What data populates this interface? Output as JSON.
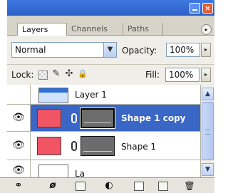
{
  "window": {
    "close_glyph": "×"
  },
  "tabs": [
    {
      "label": "Layers",
      "active": true
    },
    {
      "label": "Channels",
      "active": false
    },
    {
      "label": "Paths",
      "active": false
    }
  ],
  "panel_menu_glyph": "▸",
  "blend_mode": {
    "value": "Normal",
    "arrow": "▼"
  },
  "opacity": {
    "label": "Opacity:",
    "value": "100%",
    "arrow": "▸"
  },
  "lock": {
    "label": "Lock:",
    "icons": [
      "transparency-lock-icon",
      "brush-icon",
      "move-icon",
      "padlock-icon"
    ],
    "move_glyph": "✣",
    "brush_glyph": "✎",
    "padlock_glyph": "🔒"
  },
  "fill": {
    "label": "Fill:",
    "value": "100%",
    "arrow": "▸"
  },
  "layers": [
    {
      "name": "Layer 1",
      "visible": false,
      "selected": false,
      "type": "image"
    },
    {
      "name": "Shape 1 copy",
      "visible": true,
      "selected": true,
      "type": "shape",
      "color": "#f15564"
    },
    {
      "name": "Shape 1",
      "visible": true,
      "selected": false,
      "type": "shape",
      "color": "#f15564"
    },
    {
      "name": "La",
      "visible": true,
      "selected": false,
      "type": "image"
    }
  ],
  "eye_glyph": "👁",
  "scrollbar": {
    "up": "▲",
    "down": "▼"
  },
  "footer_icons": [
    "link-layers-icon",
    "layer-style-icon",
    "add-mask-icon",
    "adjustment-layer-icon",
    "new-group-icon",
    "new-layer-icon",
    "delete-layer-icon"
  ],
  "footer_glyphs": {
    "link": "⚭",
    "style": "ø",
    "adjust": "◐",
    "trash": "🗑"
  }
}
